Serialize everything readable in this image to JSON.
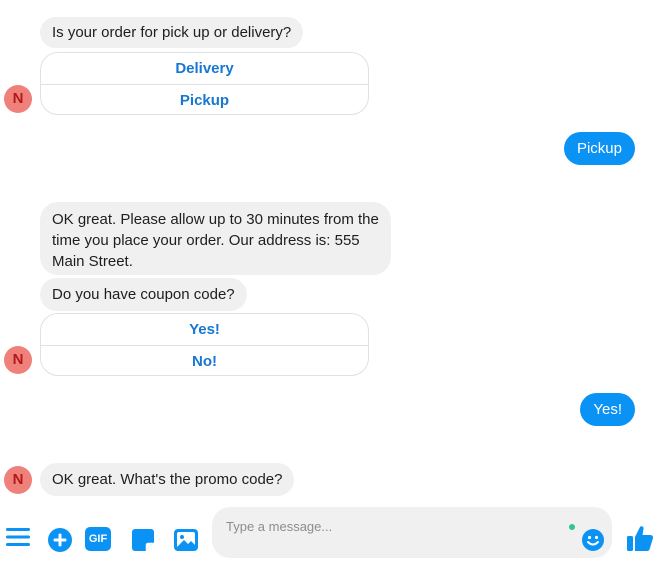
{
  "conversation": {
    "q1": {
      "text": "Is your order for pick up or delivery?",
      "options": [
        "Delivery",
        "Pickup"
      ]
    },
    "reply1": "Pickup",
    "msg2": {
      "lines": [
        "OK great. Please allow up to 30 minutes from the",
        "time you place your order. Our address is: 555",
        "Main Street."
      ]
    },
    "q2": {
      "text": "Do you have coupon code?",
      "options": [
        "Yes!",
        "No!"
      ]
    },
    "reply2": "Yes!",
    "q3": {
      "text": "OK great. What's the promo code?"
    },
    "avatar_initial": "N"
  },
  "composer": {
    "placeholder": "Type a message...",
    "gif_label": "GIF"
  },
  "colors": {
    "accent": "#0a92f5",
    "link": "#1877d2",
    "bubble_in": "#f0f0f0",
    "avatar_bg": "#f0807a",
    "status_dot": "#31c48d"
  },
  "icons": [
    "menu-icon",
    "add-icon",
    "gif-icon",
    "sticker-icon",
    "image-icon",
    "emoji-icon",
    "thumbs-up-icon"
  ]
}
